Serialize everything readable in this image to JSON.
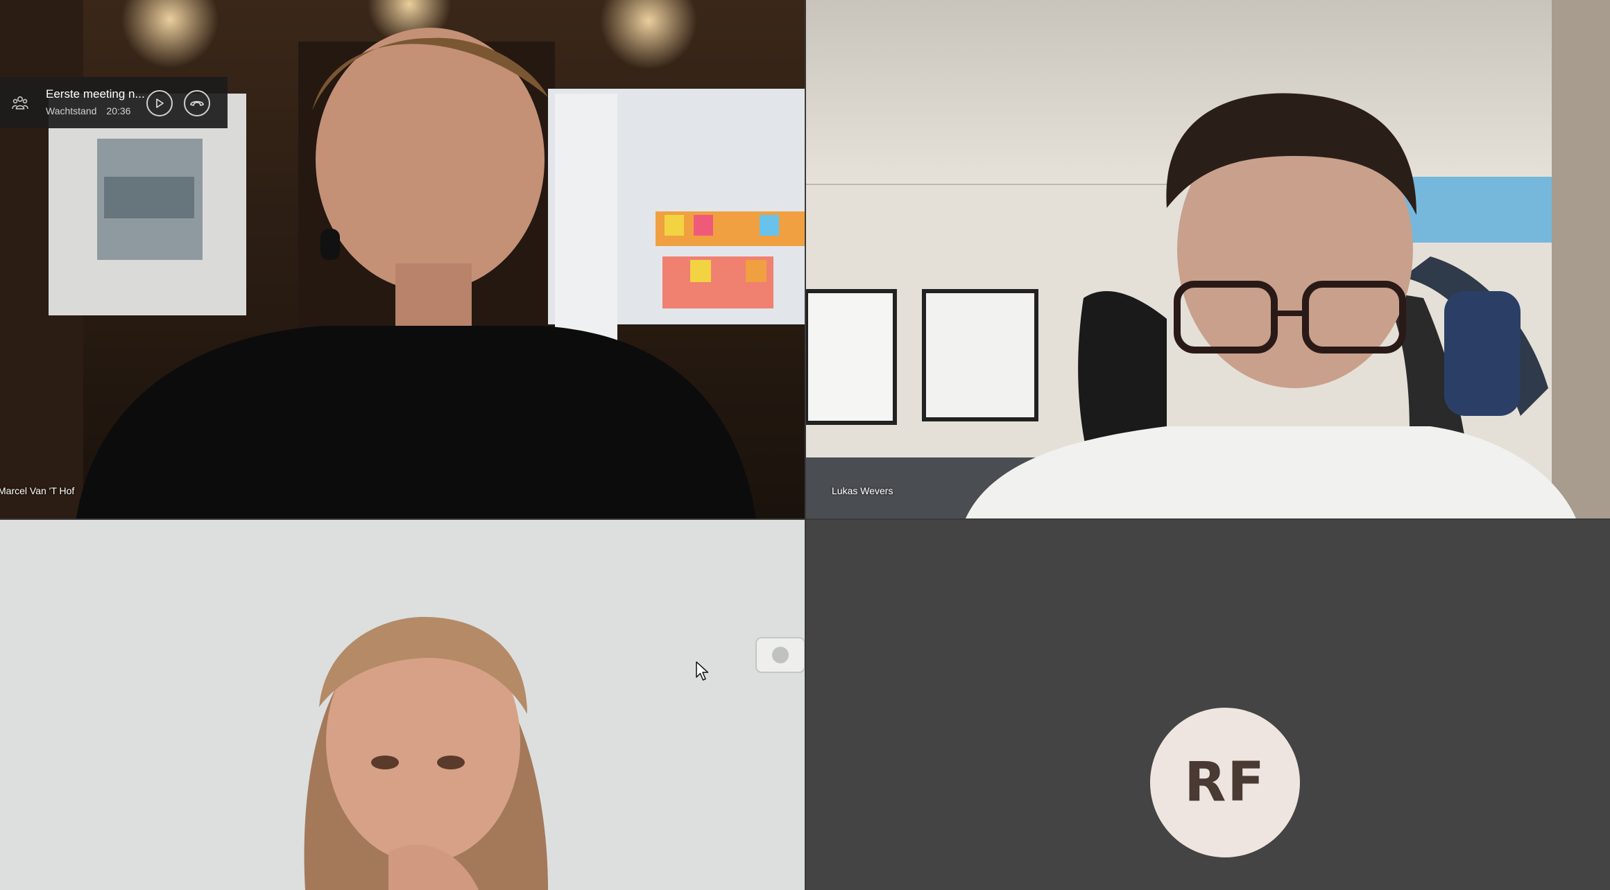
{
  "meeting": {
    "title": "Eerste meeting n...",
    "status": "Wachtstand",
    "time": "20:36"
  },
  "participants": [
    {
      "name": "Marcel Van 'T Hof"
    },
    {
      "name": "Lukas Wevers"
    },
    {
      "name": ""
    },
    {
      "initials": "RF",
      "avatar_color": "#efe5e0"
    }
  ],
  "icons": {
    "participants": "people-icon",
    "resume": "play-icon",
    "leave": "hang-up-icon"
  }
}
